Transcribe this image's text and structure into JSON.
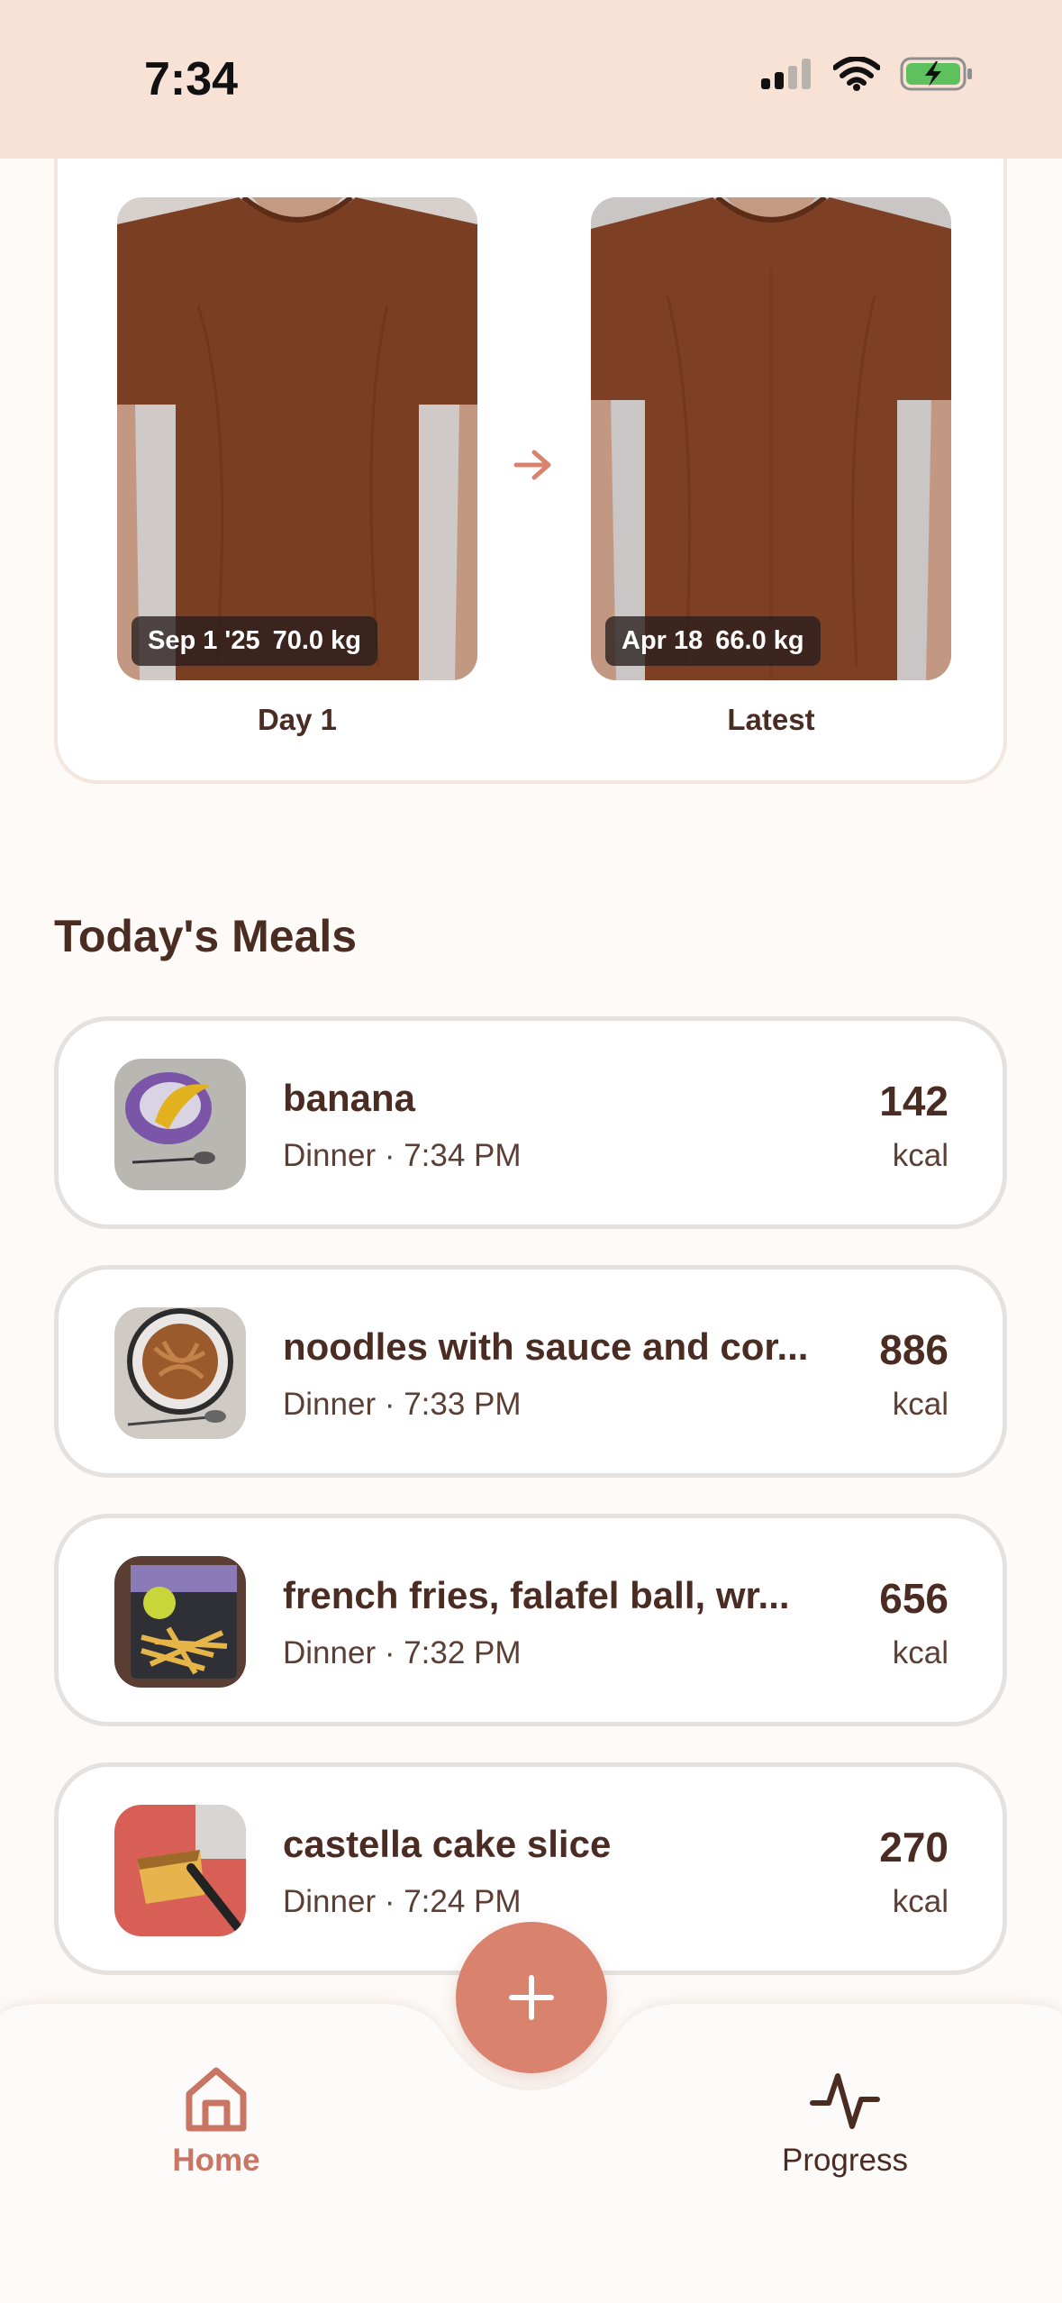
{
  "status_bar": {
    "time": "7:34"
  },
  "progress_photos": {
    "first": {
      "date": "Sep 1 '25",
      "weight": "70.0 kg",
      "caption": "Day 1"
    },
    "latest": {
      "date": "Apr 18",
      "weight": "66.0 kg",
      "caption": "Latest"
    }
  },
  "meals": {
    "title": "Today's Meals",
    "items": [
      {
        "name": "banana",
        "meta": "Dinner · 7:34 PM",
        "kcal": "142",
        "unit": "kcal"
      },
      {
        "name": "noodles with sauce and cor...",
        "meta": "Dinner · 7:33 PM",
        "kcal": "886",
        "unit": "kcal"
      },
      {
        "name": "french fries, falafel ball, wr...",
        "meta": "Dinner · 7:32 PM",
        "kcal": "656",
        "unit": "kcal"
      },
      {
        "name": "castella cake slice",
        "meta": "Dinner · 7:24 PM",
        "kcal": "270",
        "unit": "kcal"
      }
    ]
  },
  "nav": {
    "home": "Home",
    "progress": "Progress"
  },
  "colors": {
    "accent": "#d9836f",
    "text": "#4a2c23",
    "header": "#f8e2d6"
  },
  "icons": {
    "fab": "plus-icon",
    "home": "home-icon",
    "progress": "activity-icon",
    "arrow": "arrow-right-icon"
  }
}
